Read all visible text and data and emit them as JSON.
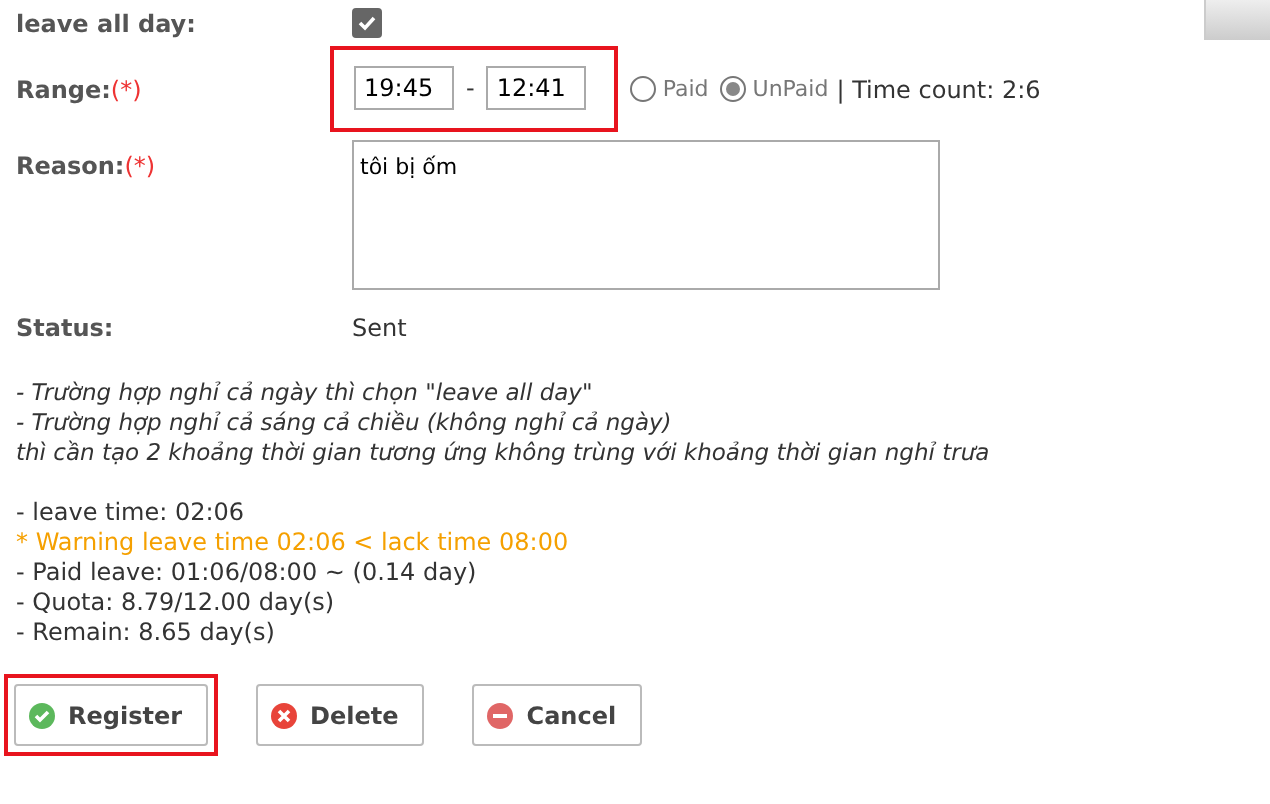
{
  "leave_all_day": {
    "label": "leave all day:",
    "checked": true
  },
  "range": {
    "label": "Range:",
    "required": "(*)",
    "from": "19:45",
    "separator": "-",
    "to": "12:41",
    "highlighted": true,
    "pay_options": [
      {
        "label": "Paid",
        "selected": false
      },
      {
        "label": "UnPaid",
        "selected": true
      }
    ],
    "time_count": "| Time count: 2:6"
  },
  "reason": {
    "label": "Reason:",
    "required": "(*)",
    "value": "tôi bị ốm"
  },
  "status": {
    "label": "Status:",
    "value": "Sent"
  },
  "notes": [
    "- Trường hợp nghỉ cả ngày thì chọn \"leave all day\"",
    "- Trường hợp nghỉ cả sáng cả chiều (không nghỉ cả ngày)",
    "thì cần tạo 2 khoảng thời gian tương ứng không trùng với khoảng thời gian nghỉ trưa"
  ],
  "summary": [
    {
      "text": "- leave time: 02:06",
      "kind": "info"
    },
    {
      "text": "* Warning leave time 02:06 < lack time 08:00",
      "kind": "warning"
    },
    {
      "text": "- Paid leave: 01:06/08:00 ~ (0.14 day)",
      "kind": "info"
    },
    {
      "text": "- Quota: 8.79/12.00 day(s)",
      "kind": "info"
    },
    {
      "text": "- Remain: 8.65 day(s)",
      "kind": "info"
    }
  ],
  "buttons": [
    {
      "label": "Register",
      "kind": "ok",
      "highlighted": true
    },
    {
      "label": "Delete",
      "kind": "delete",
      "highlighted": false
    },
    {
      "label": "Cancel",
      "kind": "cancel",
      "highlighted": false
    }
  ]
}
